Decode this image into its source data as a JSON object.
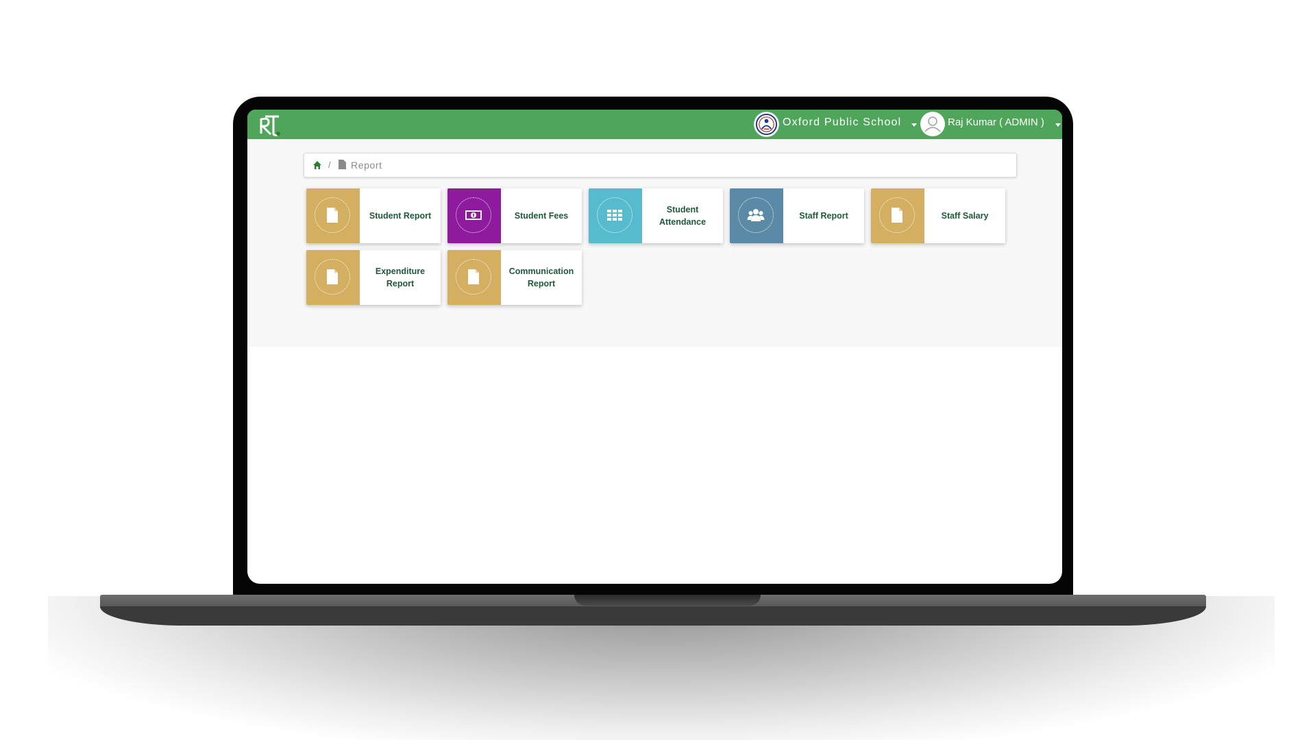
{
  "navbar": {
    "school_name": "Oxford Public School",
    "user_name": "Raj Kumar ( ADMIN )",
    "color": "#4fa65a"
  },
  "breadcrumb": {
    "current": "Report"
  },
  "tiles": [
    {
      "label": "Student Report",
      "color": "#d4af61",
      "icon": "file-icon"
    },
    {
      "label": "Student Fees",
      "color": "#8e1b9e",
      "icon": "money-icon"
    },
    {
      "label": "Student Attendance",
      "color": "#56bccd",
      "icon": "grid-icon"
    },
    {
      "label": "Staff Report",
      "color": "#5a8aa6",
      "icon": "users-icon"
    },
    {
      "label": "Staff Salary",
      "color": "#d4af61",
      "icon": "file-icon"
    },
    {
      "label": "Expenditure Report",
      "color": "#d4af61",
      "icon": "file-icon"
    },
    {
      "label": "Communication Report",
      "color": "#d4af61",
      "icon": "file-icon"
    }
  ],
  "text_color": "#1f5a3a"
}
